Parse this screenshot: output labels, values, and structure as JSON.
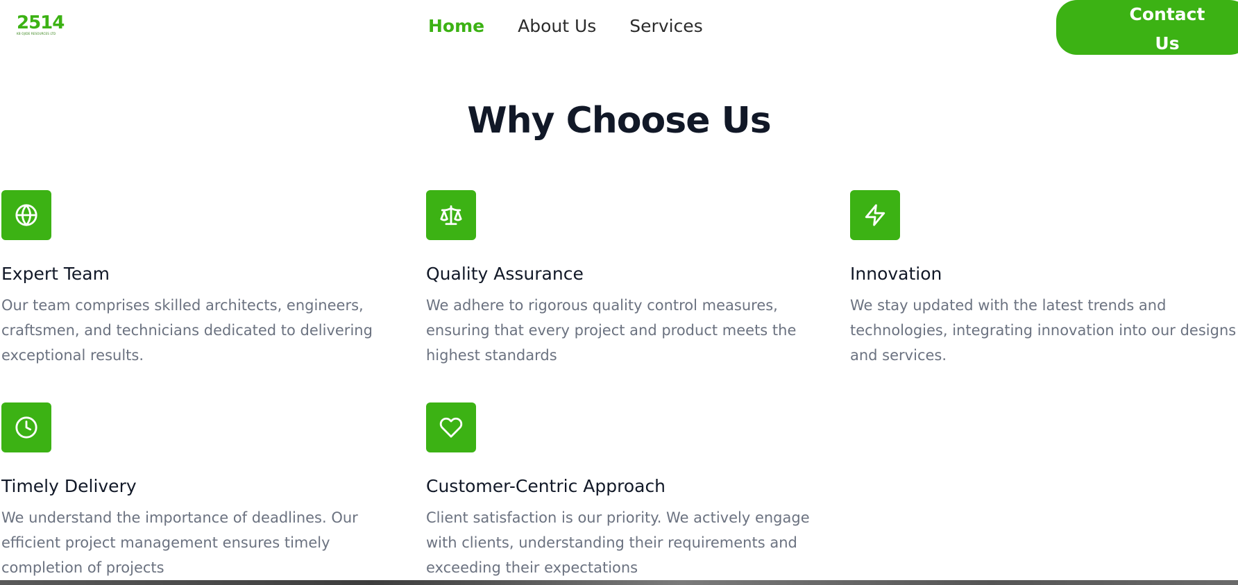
{
  "header": {
    "logo_text": "2514",
    "logo_subtext": "KB OJIDE RESOURCES LTD",
    "nav": [
      {
        "label": "Home",
        "active": true
      },
      {
        "label": "About Us",
        "active": false
      },
      {
        "label": "Services",
        "active": false
      }
    ],
    "contact_label_line1": "Contact",
    "contact_label_line2": "Us"
  },
  "section": {
    "title": "Why Choose Us",
    "features": [
      {
        "icon": "globe-icon",
        "title": "Expert Team",
        "description": "Our team comprises skilled architects, engineers, craftsmen, and technicians dedicated to delivering exceptional results."
      },
      {
        "icon": "scale-icon",
        "title": "Quality Assurance",
        "description": "We adhere to rigorous quality control measures, ensuring that every project and product meets the highest standards"
      },
      {
        "icon": "lightning-icon",
        "title": "Innovation",
        "description": "We stay updated with the latest trends and technologies, integrating innovation into our designs and services."
      },
      {
        "icon": "clock-icon",
        "title": "Timely Delivery",
        "description": "We understand the importance of deadlines. Our efficient project management ensures timely completion of projects"
      },
      {
        "icon": "heart-icon",
        "title": "Customer-Centric Approach",
        "description": "Client satisfaction is our priority. We actively engage with clients, understanding their requirements and exceeding their expectations"
      }
    ]
  },
  "colors": {
    "accent": "#3cb214",
    "heading": "#111827",
    "body_text": "#6b7280"
  }
}
